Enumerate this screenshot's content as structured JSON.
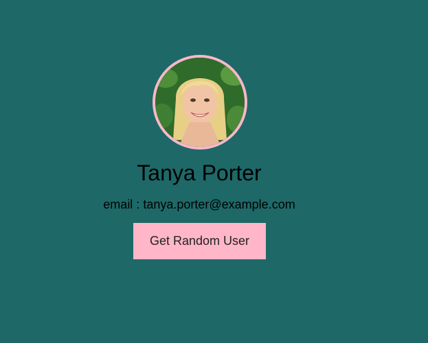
{
  "colors": {
    "background": "#1e6868",
    "avatar_border": "#f7b8c9",
    "button_bg": "#ffb6c8"
  },
  "user": {
    "name": "Tanya Porter",
    "email_label": "email : ",
    "email": "tanya.porter@example.com"
  },
  "actions": {
    "random_user_label": "Get Random User"
  }
}
